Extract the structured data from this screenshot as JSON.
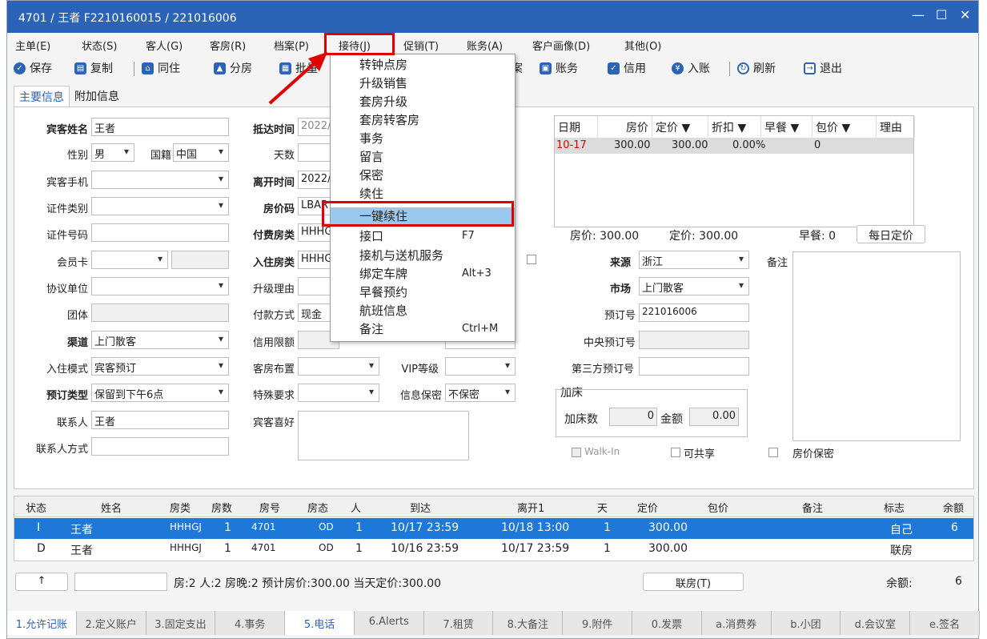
{
  "titlebar": {
    "title": "4701 / 王者 F2210160015 / 221016006",
    "minimize": "—",
    "maximize": "☐",
    "close": "✕"
  },
  "menu": [
    "主单(E)",
    "状态(S)",
    "客人(G)",
    "客房(R)",
    "档案(P)",
    "接待(J)",
    "促销(T)",
    "账务(A)",
    "客户画像(D)",
    "其他(O)"
  ],
  "toolbar": {
    "save": "保存",
    "copy": "复制",
    "cohabit": "同住",
    "split": "分房",
    "batch": "批量",
    "profile": "案",
    "account": "账务",
    "credit": "信用",
    "post": "入账",
    "refresh": "刷新",
    "exit": "退出"
  },
  "tabs": {
    "main": "主要信息",
    "extra": "附加信息"
  },
  "form": {
    "guest_name_label": "宾客姓名",
    "guest_name": "王者",
    "arrival_label": "抵达时间",
    "arrival": "2022/",
    "gender_label": "性别",
    "gender": "男",
    "nation_label": "国籍",
    "nation": "中国",
    "days_label": "天数",
    "mobile_label": "宾客手机",
    "depart_label": "离开时间",
    "depart": "2022/",
    "idtype_label": "证件类别",
    "ratecode_label": "房价码",
    "ratecode": "LBAR",
    "idno_label": "证件号码",
    "payroom_label": "付费房类",
    "payroom": "HHHGJ",
    "member_label": "会员卡",
    "checkin_room_label": "入住房类",
    "checkin_room": "HHHGJ",
    "agreement_label": "协议单位",
    "upgrade_label": "升级理由",
    "group_label": "团体",
    "paymethod_label": "付款方式",
    "paymethod": "现金",
    "channel_label": "渠道",
    "channel": "上门散客",
    "credit_label": "信用限额",
    "mode_label": "入住模式",
    "mode": "宾客预订",
    "layout_label": "客房布置",
    "vip_label": "VIP等级",
    "booktype_label": "预订类型",
    "booktype": "保留到下午6点",
    "special_label": "特殊要求",
    "secret_label": "信息保密",
    "secret": "不保密",
    "contact_label": "联系人",
    "contact": "王者",
    "prefs_label": "宾客喜好",
    "contact_way_label": "联系人方式",
    "source_label": "来源",
    "source": "浙江",
    "market_label": "市场",
    "market": "上门散客",
    "bookno_label": "预订号",
    "bookno": "221016006",
    "central_label": "中央预订号",
    "thirdparty_label": "第三方预订号",
    "memo_label": "备注"
  },
  "extra_bed": {
    "legend": "加床",
    "count_label": "加床数",
    "count": "0",
    "amount_label": "金额",
    "amount": "0.00"
  },
  "checks": {
    "walkin": "Walk-In",
    "share": "可共享",
    "rate_secret": "房价保密"
  },
  "rate_grid": {
    "headers": [
      "日期",
      "房价",
      "定价 ▼",
      "折扣 ▼",
      "早餐 ▼",
      "包价 ▼",
      "理由 ▼"
    ],
    "row": {
      "date": "10-17",
      "price": "300.00",
      "fixed": "300.00",
      "discount": "0.00%",
      "breakfast": "0"
    },
    "summary_price": "房价: 300.00",
    "summary_fixed": "定价: 300.00",
    "summary_breakfast": "早餐: 0",
    "daily_button": "每日定价"
  },
  "room_grid": {
    "headers": [
      "状态",
      "姓名",
      "房类",
      "房数",
      "房号",
      "房态",
      "人",
      "到达",
      "离开1",
      "天",
      "定价",
      "包价",
      "备注",
      "标志",
      "余额"
    ],
    "rows": [
      [
        "I",
        "王者",
        "HHHGJ",
        "1",
        "4701",
        "OD",
        "1",
        "10/17 23:59",
        "10/18 13:00",
        "1",
        "300.00",
        "",
        "",
        "自己",
        "6"
      ],
      [
        "D",
        "王者",
        "HHHGJ",
        "1",
        "4701",
        "OD",
        "1",
        "10/16 23:59",
        "10/17 23:59",
        "1",
        "300.00",
        "",
        "",
        "联房",
        ""
      ]
    ]
  },
  "status_bar": {
    "up": "↑",
    "summary": "房:2 人:2 房晚:2 预计房价:300.00 当天定价:300.00",
    "link_button": "联房(T)",
    "balance_label": "余额:",
    "balance": "6"
  },
  "bottom_tabs": [
    "1.允许记账",
    "2.定义账户",
    "3.固定支出",
    "4.事务",
    "5.电话",
    "6.Alerts",
    "7.租赁",
    "8.大备注",
    "9.附件",
    "0.发票",
    "a.消费券",
    "b.小团",
    "d.会议室",
    "e.签名"
  ],
  "dropdown": [
    {
      "label": "转钟点房",
      "shortcut": ""
    },
    {
      "label": "升级销售",
      "shortcut": ""
    },
    {
      "label": "套房升级",
      "shortcut": ""
    },
    {
      "label": "套房转客房",
      "shortcut": ""
    },
    {
      "label": "事务",
      "shortcut": ""
    },
    {
      "label": "留言",
      "shortcut": ""
    },
    {
      "label": "保密",
      "shortcut": ""
    },
    {
      "label": "续住",
      "shortcut": ""
    },
    {
      "label": "一键续住",
      "shortcut": ""
    },
    {
      "label": "接口",
      "shortcut": "F7"
    },
    {
      "label": "接机与送机服务",
      "shortcut": ""
    },
    {
      "label": "绑定车牌",
      "shortcut": "Alt+3"
    },
    {
      "label": "早餐预约",
      "shortcut": ""
    },
    {
      "label": "航班信息",
      "shortcut": ""
    },
    {
      "label": "备注",
      "shortcut": "Ctrl+M"
    }
  ],
  "colors": {
    "titlebar": "#2b63b6",
    "selection": "#1e78d7",
    "highlight": "#99c9ef",
    "annotation": "#e00000"
  }
}
